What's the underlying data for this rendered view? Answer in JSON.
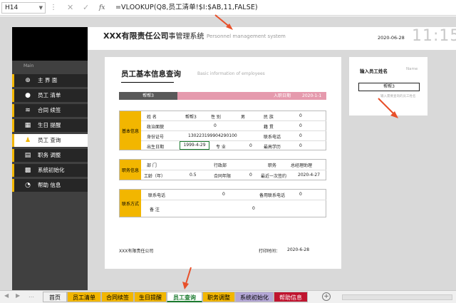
{
  "formula_bar": {
    "cell_ref": "H14",
    "fx": "fx",
    "formula": "=VLOOKUP(Q8,员工清单!$I:$AB,11,FALSE)"
  },
  "banner": {
    "company": "XXX有限责任公司",
    "system": "事管理系统",
    "subtitle": "Personnel management system",
    "date": "2020-06-28",
    "time": "11:15"
  },
  "sidebar": {
    "section": "Main",
    "items": [
      {
        "label": "主  界  面",
        "icon": "plus-circle-icon"
      },
      {
        "label": "员工 清单",
        "icon": "user-icon"
      },
      {
        "label": "合同 续签",
        "icon": "layers-icon"
      },
      {
        "label": "生日 提醒",
        "icon": "calendar-icon"
      },
      {
        "label": "员工 查询",
        "icon": "search-user-icon"
      },
      {
        "label": "职务 调整",
        "icon": "list-icon"
      },
      {
        "label": "系统初始化",
        "icon": "grid-icon"
      },
      {
        "label": "帮助 信息",
        "icon": "clock-icon"
      }
    ],
    "active_index": 4
  },
  "card": {
    "title": "员工基本信息查询",
    "subtitle": "Basic information of employees",
    "name_value": "帮帮3",
    "hire_label": "入职日期",
    "hire_value": "2020-1-1",
    "basic": {
      "header": "基本信息",
      "name_l": "姓  名",
      "name_v": "帮帮3",
      "gender_l": "性  别",
      "gender_v": "男",
      "ethnic_l": "民  族",
      "ethnic_v": "0",
      "political_l": "政治面貌",
      "political_v": "0",
      "origin_l": "籍  贯",
      "origin_v": "0",
      "id_l": "身份证号",
      "id_v": "130223199904290100",
      "phone_l": "联系电话",
      "phone_v": "0",
      "birth_l": "出生日期",
      "birth_v": "1999-4-29",
      "major_l": "专  业",
      "major_v": "0",
      "edu_l": "最高学历",
      "edu_v": "0"
    },
    "job": {
      "header": "职务信息",
      "dept_l": "部  门",
      "dept_v": "行政部",
      "pos_l": "职务",
      "pos_v": "总经理助理",
      "age_l": "工龄（年）",
      "age_v": "0.5",
      "contract_l": "合同年限",
      "contract_v": "0",
      "adjust_l": "最近一次签约",
      "adjust_v": "2020-4-27"
    },
    "contact": {
      "header": "联系方式",
      "phone_l": "联系电话",
      "phone_v": "0",
      "backup_l": "备用联系电话",
      "backup_v": "0",
      "note_l": "备  注",
      "note_v": "0"
    },
    "footer_company": "XXX有限责任公司",
    "print_label": "打印时间：",
    "print_date": "2020-6-28"
  },
  "input_card": {
    "title": "输入员工姓名",
    "name_hint": "Name",
    "value": "帮帮3",
    "hint": "输入需要查询的员工姓名"
  },
  "sheet_tabs": [
    {
      "label": "首页",
      "bg": "#f0f0f0",
      "fg": "#000"
    },
    {
      "label": "员工清单",
      "bg": "#f2b600",
      "fg": "#000"
    },
    {
      "label": "合同续签",
      "bg": "#f2b600",
      "fg": "#000"
    },
    {
      "label": "生日提醒",
      "bg": "#f2b600",
      "fg": "#000"
    },
    {
      "label": "员工查询",
      "bg": "#ffffff",
      "fg": "#1a7a2e"
    },
    {
      "label": "职务调整",
      "bg": "#f2b600",
      "fg": "#000"
    },
    {
      "label": "系统初始化",
      "bg": "#b4a7d6",
      "fg": "#000"
    },
    {
      "label": "帮助信息",
      "bg": "#c0142f",
      "fg": "#fff"
    }
  ],
  "colors": {
    "accent": "#f2b600",
    "pink": "#e59aad",
    "arrow": "#e8502a"
  }
}
